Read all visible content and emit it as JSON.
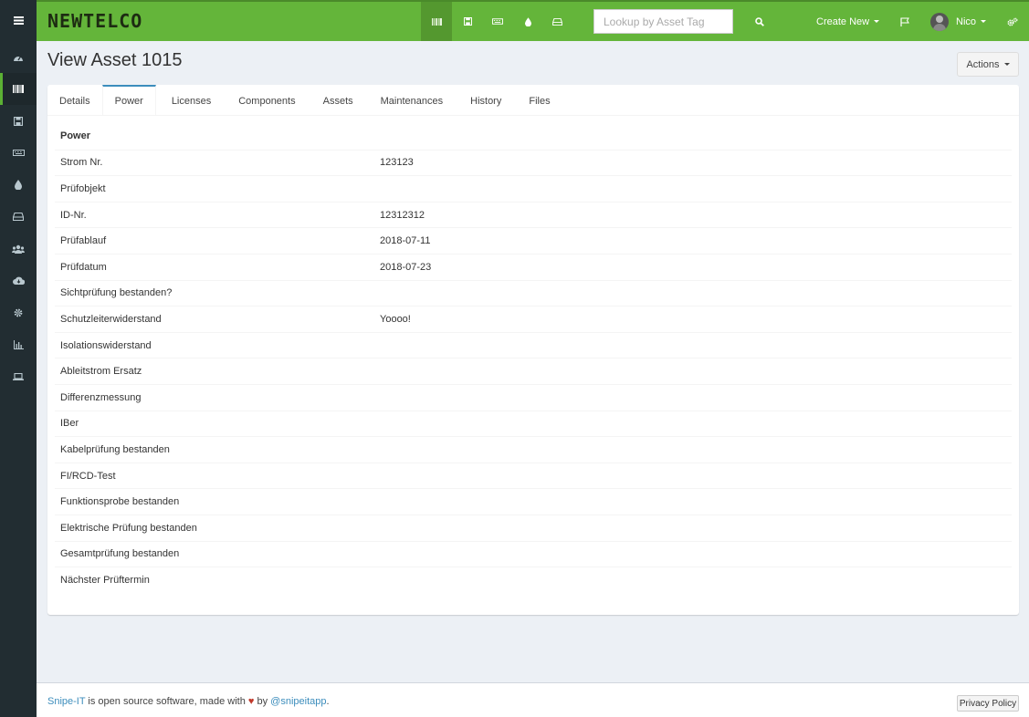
{
  "app": {
    "logo_text": "NEWTELCO",
    "brand_color": "#64b53a",
    "sidebar_color": "#222d32"
  },
  "sidebar": {
    "items": [
      {
        "icon": "dashboard-icon"
      },
      {
        "icon": "barcode-icon",
        "active": true
      },
      {
        "icon": "floppy-disk-icon"
      },
      {
        "icon": "keyboard-icon"
      },
      {
        "icon": "tint-drop-icon"
      },
      {
        "icon": "hard-drive-icon"
      },
      {
        "icon": "users-icon"
      },
      {
        "icon": "cloud-download-icon"
      },
      {
        "icon": "cog-icon"
      },
      {
        "icon": "bar-chart-icon"
      },
      {
        "icon": "laptop-icon"
      }
    ]
  },
  "header": {
    "search_placeholder": "Lookup by Asset Tag",
    "create_new_label": "Create New",
    "user_name": "Nico"
  },
  "page": {
    "title": "View Asset 1015",
    "actions_label": "Actions"
  },
  "tabs": [
    {
      "label": "Details"
    },
    {
      "label": "Power",
      "active": true
    },
    {
      "label": "Licenses"
    },
    {
      "label": "Components"
    },
    {
      "label": "Assets"
    },
    {
      "label": "Maintenances"
    },
    {
      "label": "History"
    },
    {
      "label": "Files"
    }
  ],
  "power": {
    "heading": "Power",
    "rows": [
      {
        "label": "Strom Nr.",
        "value": "123123"
      },
      {
        "label": "Prüfobjekt",
        "value": ""
      },
      {
        "label": "ID-Nr.",
        "value": "12312312"
      },
      {
        "label": "Prüfablauf",
        "value": "2018-07-11"
      },
      {
        "label": "Prüfdatum",
        "value": "2018-07-23"
      },
      {
        "label": "Sichtprüfung bestanden?",
        "value": ""
      },
      {
        "label": "Schutzleiterwiderstand",
        "value": "Yoooo!"
      },
      {
        "label": "Isolationswiderstand",
        "value": ""
      },
      {
        "label": "Ableitstrom Ersatz",
        "value": ""
      },
      {
        "label": "Differenzmessung",
        "value": ""
      },
      {
        "label": "IBer",
        "value": ""
      },
      {
        "label": "Kabelprüfung bestanden",
        "value": ""
      },
      {
        "label": "FI/RCD-Test",
        "value": ""
      },
      {
        "label": "Funktionsprobe bestanden",
        "value": ""
      },
      {
        "label": "Elektrische Prüfung bestanden",
        "value": ""
      },
      {
        "label": "Gesamtprüfung bestanden",
        "value": ""
      },
      {
        "label": "Nächster Prüftermin",
        "value": ""
      }
    ]
  },
  "footer": {
    "link_snipeit": "Snipe-IT",
    "text_middle": " is open source software, made with ",
    "heart": "♥",
    "text_by": " by ",
    "link_handle": "@snipeitapp",
    "text_end": ".",
    "privacy_label": "Privacy Policy"
  }
}
